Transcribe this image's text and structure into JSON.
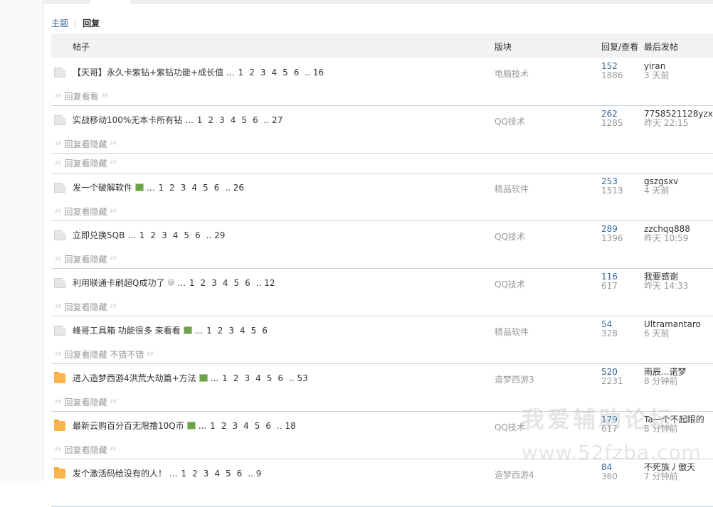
{
  "subnav": {
    "topics": "主题",
    "replies": "回复"
  },
  "table_head": {
    "thread": "帖子",
    "forum": "版块",
    "counts": "回复/查看",
    "lastpost": "最后发帖"
  },
  "rows": [
    {
      "title": "【天哥】永久卡紫钻+紫钻功能+成长值",
      "icon": "gray",
      "img": false,
      "attach": false,
      "pages": [
        "1",
        "2",
        "3",
        "4",
        "5",
        "6",
        ".. 16"
      ],
      "forum": "电脑技术",
      "replies": "152",
      "views": "1886",
      "author": "yiran",
      "time": "3 天前",
      "quote": "回复看看"
    },
    {
      "title": "实战移动100%无本卡所有钻",
      "icon": "gray",
      "img": false,
      "attach": false,
      "pages": [
        "1",
        "2",
        "3",
        "4",
        "5",
        "6",
        ".. 27"
      ],
      "forum": "QQ技术",
      "replies": "262",
      "views": "1285",
      "author": "7758521128yzx",
      "time": "昨天 22:15",
      "quote": "回复看隐藏"
    },
    {
      "title": "发一个破解软件",
      "icon": "gray",
      "img": true,
      "attach": false,
      "pages": [
        "1",
        "2",
        "3",
        "4",
        "5",
        "6",
        ".. 26"
      ],
      "forum": "精品软件",
      "replies": "253",
      "views": "1513",
      "author": "gszgsxv",
      "time": "4 天前",
      "quote": "回复看隐藏"
    },
    {
      "title": "立即兑换5QB",
      "icon": "gray",
      "img": false,
      "attach": false,
      "pages": [
        "1",
        "2",
        "3",
        "4",
        "5",
        "6",
        ".. 29"
      ],
      "forum": "QQ技术",
      "replies": "289",
      "views": "1396",
      "author": "zzchqq888",
      "time": "昨天 10:59",
      "quote": "回复看隐藏"
    },
    {
      "title": "利用联通卡刷超Q成功了",
      "icon": "gray",
      "img": false,
      "attach": true,
      "pages": [
        "1",
        "2",
        "3",
        "4",
        "5",
        "6",
        ".. 12"
      ],
      "forum": "QQ技术",
      "replies": "116",
      "views": "617",
      "author": "我要感谢",
      "time": "昨天 14:33",
      "quote": "回复看隐藏"
    },
    {
      "title": "峰哥工具箱 功能很多 来看看",
      "icon": "gray",
      "img": true,
      "attach": false,
      "pages": [
        "1",
        "2",
        "3",
        "4",
        "5",
        "6"
      ],
      "forum": "精品软件",
      "replies": "54",
      "views": "328",
      "author": "Ultramantaro",
      "time": "6 天前",
      "quote": "回复看隐藏 不错不错"
    },
    {
      "title": "进入造梦西游4洪荒大劫篇+方法",
      "icon": "orange",
      "img": true,
      "attach": false,
      "pages": [
        "1",
        "2",
        "3",
        "4",
        "5",
        "6",
        ".. 53"
      ],
      "forum": "造梦西游3",
      "replies": "520",
      "views": "2231",
      "author": "雨辰...诺梦",
      "time": "8 分钟前",
      "quote": "回复看隐藏"
    },
    {
      "title": "最新云购百分百无限撸10Q币",
      "icon": "orange",
      "img": true,
      "attach": false,
      "pages": [
        "1",
        "2",
        "3",
        "4",
        "5",
        "6",
        ".. 18"
      ],
      "forum": "QQ技术",
      "replies": "179",
      "views": "617",
      "author": "Ta一个不起眼的",
      "time": "8 分钟前",
      "quote": "回复看隐藏"
    },
    {
      "title": "发个激活码给没有的人！",
      "icon": "orange",
      "img": false,
      "attach": false,
      "pages": [
        "1",
        "2",
        "3",
        "4",
        "5",
        "6",
        ".. 9"
      ],
      "forum": "造梦西游4",
      "replies": "84",
      "views": "360",
      "author": "不死族丿傲天",
      "time": "7 分钟前",
      "quote": ""
    }
  ],
  "extra_quote": "回复看隐藏",
  "ellipsis": "...",
  "watermark": {
    "line1": "我爱辅助论坛",
    "line2": "www.52fzba.com"
  }
}
